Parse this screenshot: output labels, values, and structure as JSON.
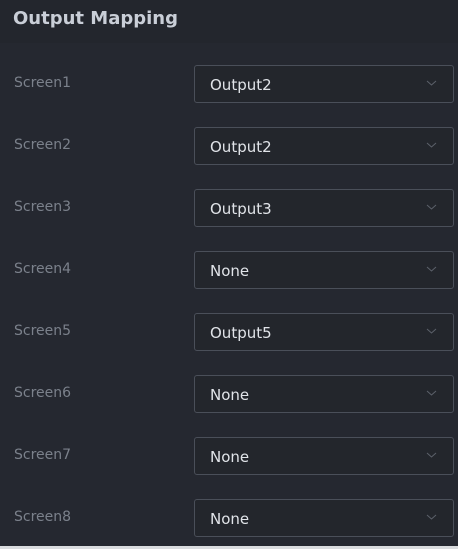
{
  "panel": {
    "title": "Output Mapping",
    "rows": [
      {
        "label": "Screen1",
        "value": "Output2"
      },
      {
        "label": "Screen2",
        "value": "Output2"
      },
      {
        "label": "Screen3",
        "value": "Output3"
      },
      {
        "label": "Screen4",
        "value": "None"
      },
      {
        "label": "Screen5",
        "value": "Output5"
      },
      {
        "label": "Screen6",
        "value": "None"
      },
      {
        "label": "Screen7",
        "value": "None"
      },
      {
        "label": "Screen8",
        "value": "None"
      }
    ]
  },
  "icons": {
    "dropdown": "chevron-down-icon"
  },
  "colors": {
    "panel_background": "#252830",
    "header_background": "#23262d",
    "title_text": "#c9ced7",
    "label_text": "#7b818b",
    "select_border": "#4a4f59",
    "select_text": "#e1e4e9"
  }
}
